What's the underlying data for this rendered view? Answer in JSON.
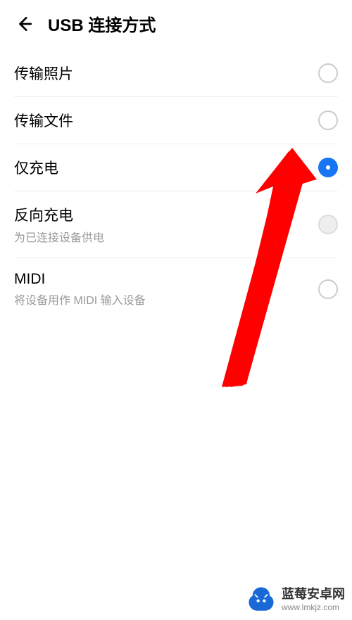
{
  "header": {
    "title": "USB 连接方式"
  },
  "options": [
    {
      "title": "传输照片",
      "sub": "",
      "selected": false,
      "disabled": false
    },
    {
      "title": "传输文件",
      "sub": "",
      "selected": false,
      "disabled": false
    },
    {
      "title": "仅充电",
      "sub": "",
      "selected": true,
      "disabled": false
    },
    {
      "title": "反向充电",
      "sub": "为已连接设备供电",
      "selected": false,
      "disabled": true
    },
    {
      "title": "MIDI",
      "sub": "将设备用作 MIDI 输入设备",
      "selected": false,
      "disabled": false
    }
  ],
  "watermark": {
    "title": "蓝莓安卓网",
    "url": "www.lmkjz.com"
  },
  "colors": {
    "accent": "#1976f2",
    "arrow": "#ff0000",
    "wm_logo": "#1868d6"
  }
}
